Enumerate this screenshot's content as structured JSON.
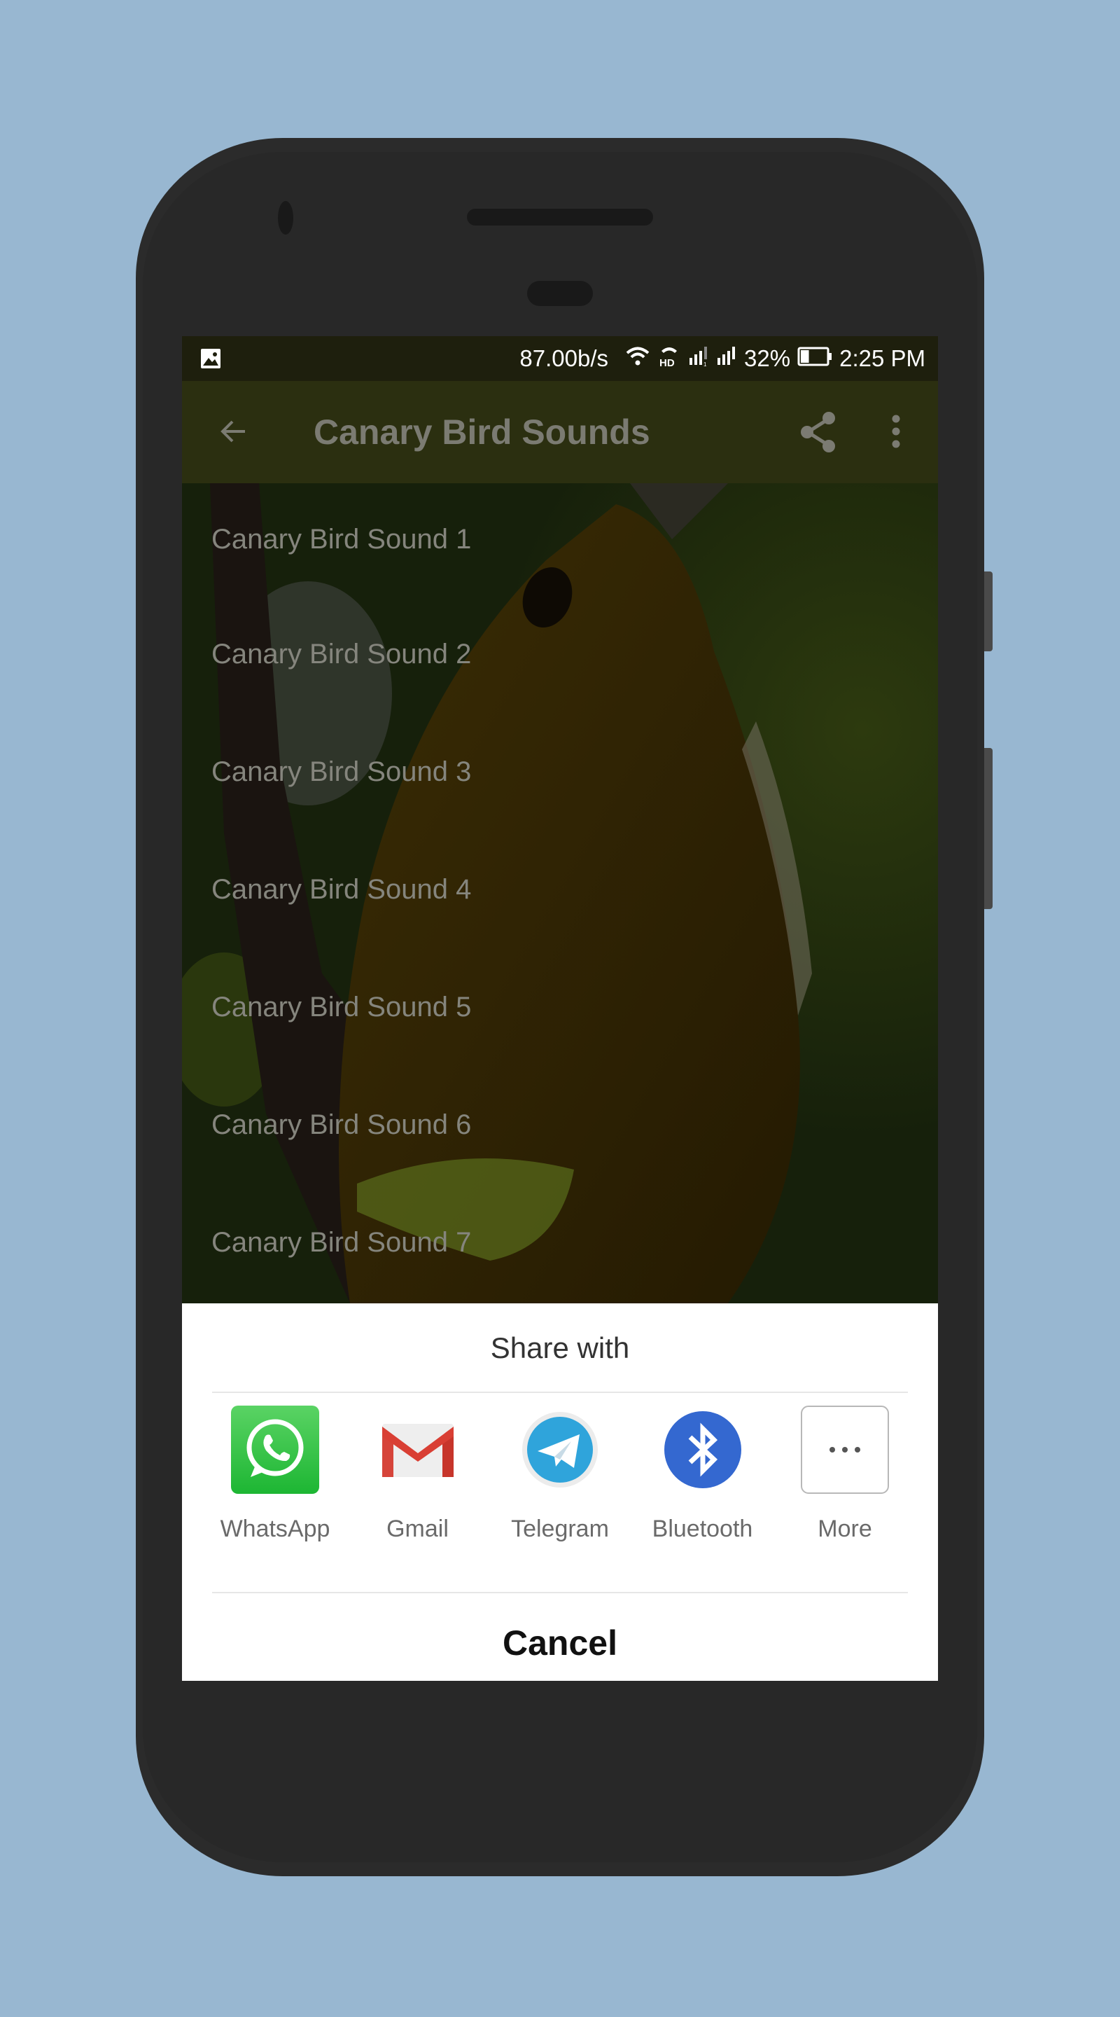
{
  "status_bar": {
    "notification_icon": "image-icon",
    "network_speed": "87.00b/s",
    "icons": [
      "wifi-icon",
      "hd-call-icon",
      "signal-sim1-icon",
      "signal-sim2-icon"
    ],
    "battery_percent": "32%",
    "battery_level": 0.32,
    "time": "2:25 PM"
  },
  "app_bar": {
    "back_icon": "arrow-back-icon",
    "title": "Canary Bird Sounds",
    "share_icon": "share-icon",
    "overflow_icon": "more-vert-icon",
    "background_color": "#2b2f10"
  },
  "sound_list": {
    "items": [
      {
        "label": "Canary Bird Sound 1"
      },
      {
        "label": "Canary Bird Sound 2"
      },
      {
        "label": "Canary Bird Sound 3"
      },
      {
        "label": "Canary Bird Sound 4"
      },
      {
        "label": "Canary Bird Sound 5"
      },
      {
        "label": "Canary Bird Sound 6"
      },
      {
        "label": "Canary Bird Sound 7"
      }
    ]
  },
  "share_sheet": {
    "title": "Share with",
    "apps": [
      {
        "label": "WhatsApp",
        "icon": "whatsapp-icon",
        "color": "#25c53f"
      },
      {
        "label": "Gmail",
        "icon": "gmail-icon",
        "color": "#d93f34"
      },
      {
        "label": "Telegram",
        "icon": "telegram-icon",
        "color": "#2fa4db"
      },
      {
        "label": "Bluetooth",
        "icon": "bluetooth-icon",
        "color": "#3366cc"
      },
      {
        "label": "More",
        "icon": "more-horiz-icon",
        "color": "#555555"
      }
    ],
    "cancel_label": "Cancel"
  },
  "colors": {
    "page_background": "#98b7d1",
    "phone_body": "#2b2b2b",
    "status_bar": "#1e1f0d"
  }
}
